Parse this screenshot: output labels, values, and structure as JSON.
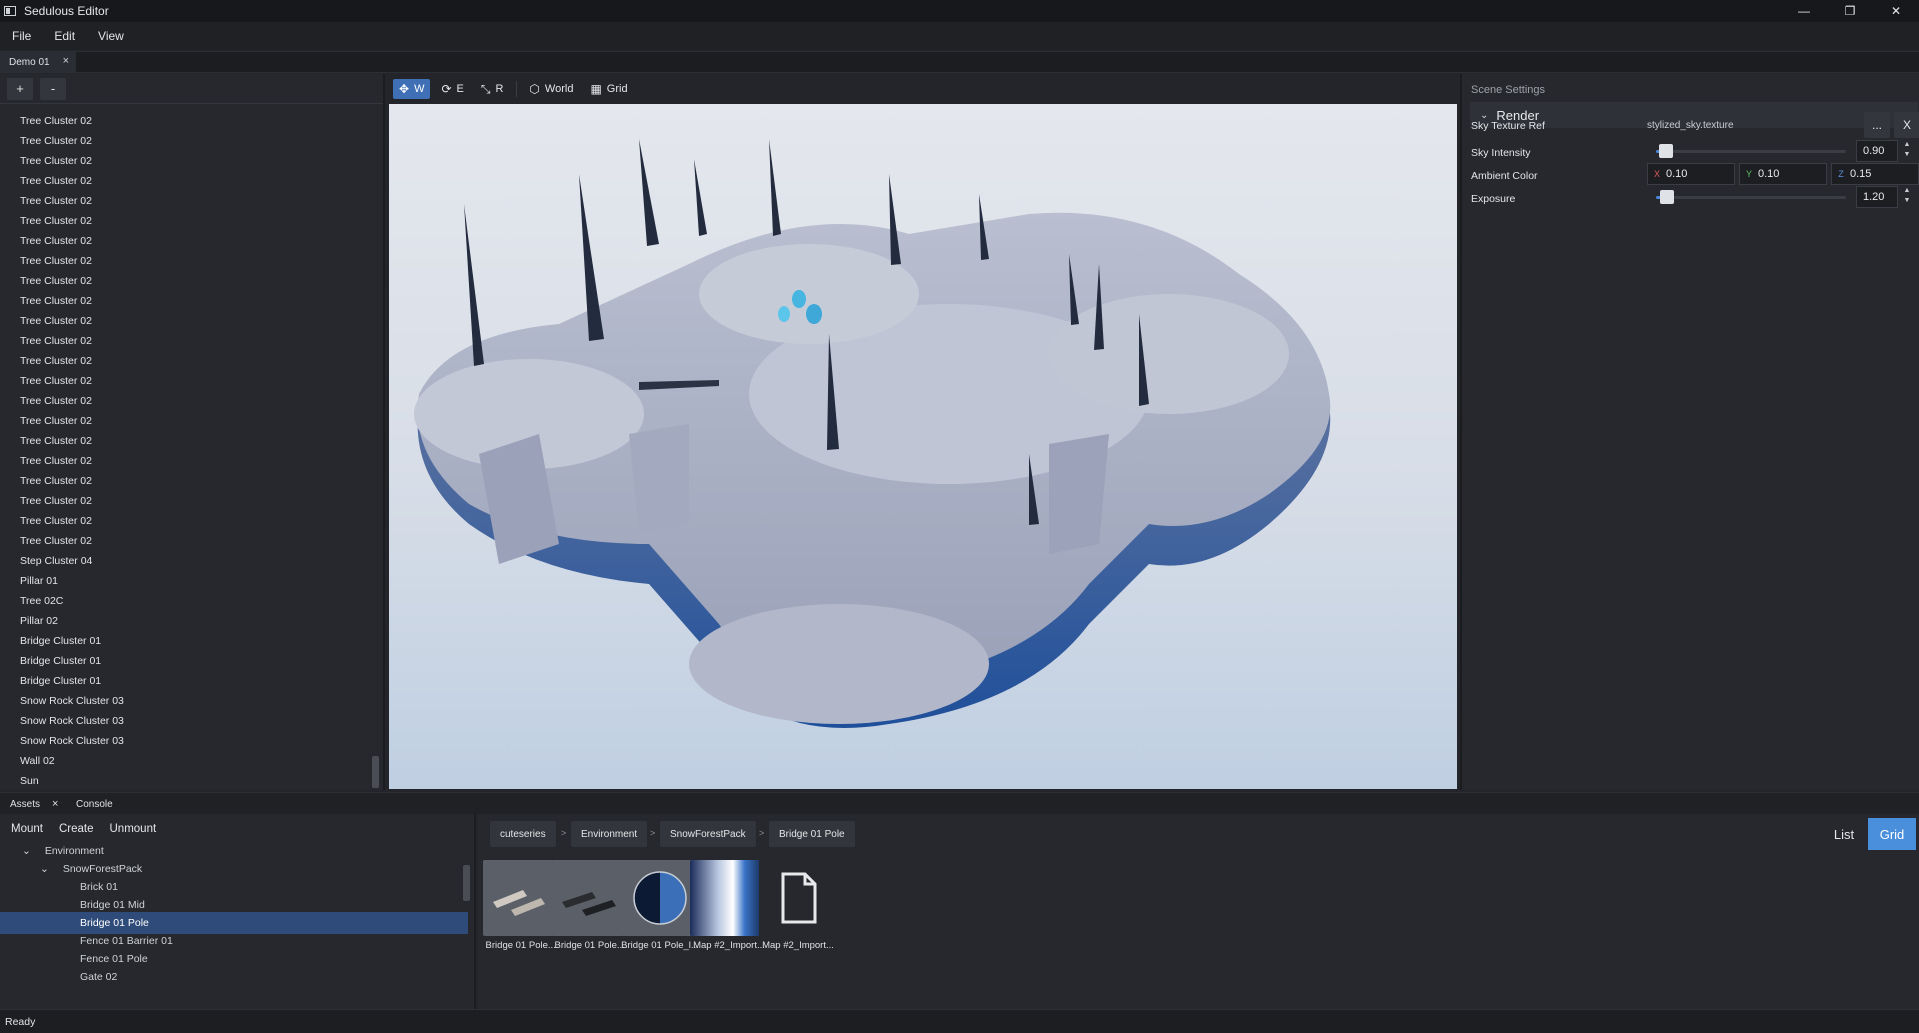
{
  "app": {
    "title": "Sedulous Editor"
  },
  "menu": [
    "File",
    "Edit",
    "View"
  ],
  "document_tab": {
    "label": "Demo 01",
    "close": "×"
  },
  "scene_panel": {
    "add_label": "+",
    "remove_label": "-",
    "items": [
      "Tree Cluster 02",
      "Tree Cluster 02",
      "Tree Cluster 02",
      "Tree Cluster 02",
      "Tree Cluster 02",
      "Tree Cluster 02",
      "Tree Cluster 02",
      "Tree Cluster 02",
      "Tree Cluster 02",
      "Tree Cluster 02",
      "Tree Cluster 02",
      "Tree Cluster 02",
      "Tree Cluster 02",
      "Tree Cluster 02",
      "Tree Cluster 02",
      "Tree Cluster 02",
      "Tree Cluster 02",
      "Tree Cluster 02",
      "Tree Cluster 02",
      "Tree Cluster 02",
      "Tree Cluster 02",
      "Tree Cluster 02",
      "Step Cluster 04",
      "Pillar 01",
      "Tree 02C",
      "Pillar 02",
      "Bridge Cluster 01",
      "Bridge Cluster 01",
      "Bridge Cluster 01",
      "Snow Rock Cluster 03",
      "Snow Rock Cluster 03",
      "Snow Rock Cluster 03",
      "Wall 02",
      "Sun"
    ]
  },
  "viewport_toolbar": {
    "translate": "W",
    "rotate": "E",
    "scale": "R",
    "space": "World",
    "grid": "Grid"
  },
  "scene_settings": {
    "header": "Scene Settings",
    "group": "Render",
    "sky_texture_label": "Sky Texture Ref",
    "sky_texture_value": "stylized_sky.texture",
    "browse_label": "...",
    "clear_label": "X",
    "sky_intensity_label": "Sky Intensity",
    "sky_intensity_value": "0.90",
    "sky_intensity_level": 0.9,
    "ambient_label": "Ambient Color",
    "ambient": {
      "x_label": "X",
      "x": "0.10",
      "y_label": "Y",
      "y": "0.10",
      "z_label": "Z",
      "z": "0.15"
    },
    "exposure_label": "Exposure",
    "exposure_value": "1.20",
    "exposure_level": 0.06
  },
  "bottom_tabs": {
    "assets": "Assets",
    "close": "×",
    "console": "Console"
  },
  "asset_tree": {
    "toolbar": [
      "Mount",
      "Create",
      "Unmount"
    ],
    "rows": [
      {
        "label": "Environment",
        "depth": 1,
        "arrow": "⌄"
      },
      {
        "label": "SnowForestPack",
        "depth": 2,
        "arrow": "⌄"
      },
      {
        "label": "Brick 01",
        "depth": 3
      },
      {
        "label": "Bridge 01 Mid",
        "depth": 3
      },
      {
        "label": "Bridge 01 Pole",
        "depth": 3,
        "selected": true
      },
      {
        "label": "Fence 01 Barrier 01",
        "depth": 3
      },
      {
        "label": "Fence 01 Pole",
        "depth": 3
      },
      {
        "label": "Gate 02",
        "depth": 3
      }
    ]
  },
  "asset_grid": {
    "breadcrumbs": [
      "cuteseries",
      "Environment",
      "SnowForestPack",
      "Bridge 01 Pole"
    ],
    "crumb_sep": ">",
    "list_label": "List",
    "grid_label": "Grid",
    "items": [
      {
        "label": "Bridge 01 Pole....",
        "kind": "mesh-light",
        "dot": true
      },
      {
        "label": "Bridge 01 Pole....",
        "kind": "mesh-dark",
        "dot": true
      },
      {
        "label": "Bridge 01 Pole_l...",
        "kind": "material",
        "dot": true
      },
      {
        "label": "Map #2_Import...",
        "kind": "texture",
        "dot": true
      },
      {
        "label": "Map #2_Import...",
        "kind": "file",
        "dot": false
      }
    ]
  },
  "status": {
    "text": "Ready"
  },
  "colors": {
    "accent": "#3f6fb5",
    "selection": "#2f4b79",
    "ok_dot": "#49c25a"
  }
}
